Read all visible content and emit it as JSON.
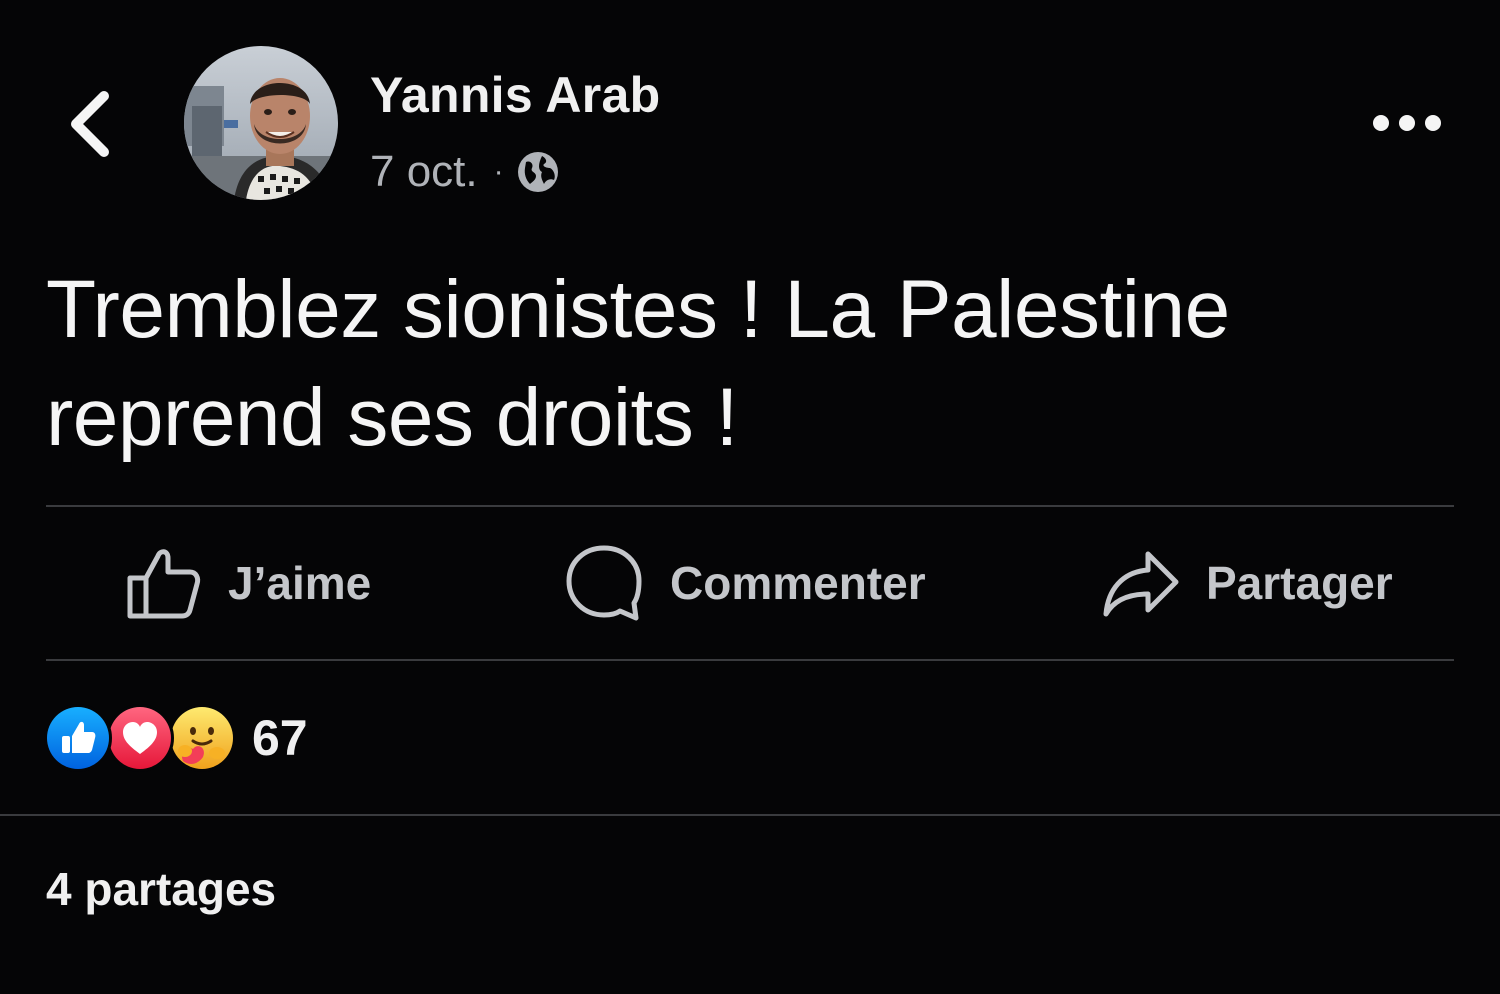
{
  "post": {
    "author": "Yannis Arab",
    "date": "7 oct.",
    "separator": "·",
    "privacy_icon": "globe-icon",
    "text": "Tremblez sionistes ! La Palestine reprend ses droits !"
  },
  "actions": {
    "like_label": "J’aime",
    "comment_label": "Commenter",
    "share_label": "Partager"
  },
  "reactions": {
    "icons": [
      "like-reaction-icon",
      "love-reaction-icon",
      "care-reaction-icon"
    ],
    "count": "67"
  },
  "shares_text": "4 partages",
  "colors": {
    "background": "#050506",
    "like_blue": "#1877f2",
    "love_red": "#f33e58",
    "care_yellow": "#f7b125",
    "divider": "#3a3b3e"
  }
}
